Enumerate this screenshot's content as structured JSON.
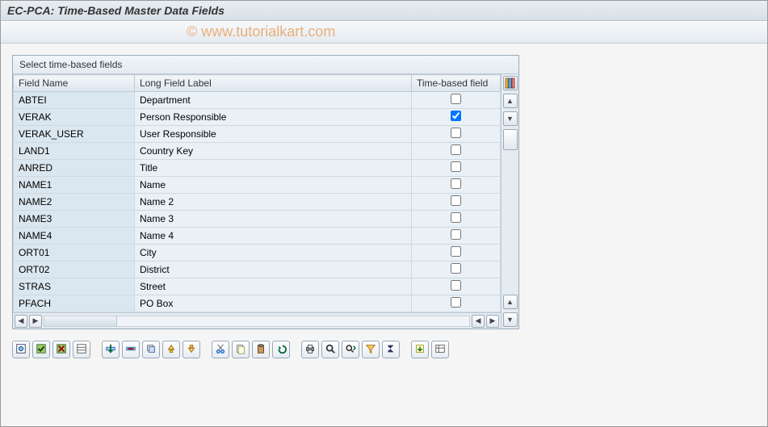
{
  "title": "EC-PCA: Time-Based Master Data Fields",
  "watermark": "© www.tutorialkart.com",
  "panel": {
    "title": "Select time-based fields"
  },
  "columns": {
    "field_name": "Field Name",
    "long_label": "Long Field Label",
    "time_based": "Time-based field"
  },
  "rows": [
    {
      "field": "ABTEI",
      "label": "Department",
      "checked": false
    },
    {
      "field": "VERAK",
      "label": "Person Responsible",
      "checked": true
    },
    {
      "field": "VERAK_USER",
      "label": "User Responsible",
      "checked": false
    },
    {
      "field": "LAND1",
      "label": "Country Key",
      "checked": false
    },
    {
      "field": "ANRED",
      "label": "Title",
      "checked": false
    },
    {
      "field": "NAME1",
      "label": "Name",
      "checked": false
    },
    {
      "field": "NAME2",
      "label": "Name 2",
      "checked": false
    },
    {
      "field": "NAME3",
      "label": "Name 3",
      "checked": false
    },
    {
      "field": "NAME4",
      "label": "Name 4",
      "checked": false
    },
    {
      "field": "ORT01",
      "label": "City",
      "checked": false
    },
    {
      "field": "ORT02",
      "label": "District",
      "checked": false
    },
    {
      "field": "STRAS",
      "label": "Street",
      "checked": false
    },
    {
      "field": "PFACH",
      "label": "PO Box",
      "checked": false
    }
  ],
  "toolbar_icons": [
    "details",
    "select-all",
    "deselect-all",
    "layout",
    "sep",
    "insert-row",
    "delete-row",
    "copy-row",
    "sort-asc",
    "sort-desc",
    "sep",
    "cut",
    "copy",
    "paste",
    "undo",
    "sep",
    "print",
    "find",
    "find-next",
    "filter",
    "sum",
    "sep",
    "export",
    "settings"
  ]
}
